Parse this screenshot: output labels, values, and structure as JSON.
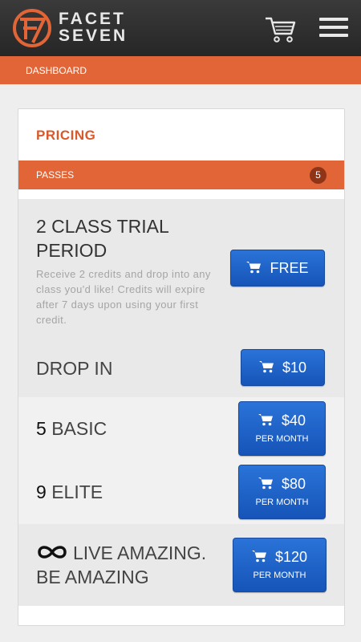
{
  "header": {
    "brand_line1": "FACET",
    "brand_line2": "SEVEN",
    "logo_icon": "facet-seven-logo",
    "cart_icon": "shopping-cart-icon",
    "menu_icon": "hamburger-menu-icon"
  },
  "breadcrumb": {
    "label": "DASHBOARD"
  },
  "pricing": {
    "title": "PRICING",
    "section_label": "PASSES",
    "section_count": "5",
    "plans": [
      {
        "name_line1": "2 CLASS TRIAL",
        "name_line2": "PERIOD",
        "description": "Receive 2 credits and drop into any class you'd like! Credits will expire after 7 days upon using your first credit.",
        "price": "FREE"
      },
      {
        "name": "DROP IN",
        "price": "$10"
      },
      {
        "name_num": "5",
        "name_text": "BASIC",
        "price": "$40",
        "period": "PER MONTH"
      },
      {
        "name_num": "9",
        "name_text": "ELITE",
        "price": "$80",
        "period": "PER MONTH"
      },
      {
        "name_line1": "LIVE AMAZING.",
        "name_line2": "BE AMAZING",
        "price": "$120",
        "period": "PER MONTH",
        "prefix_icon": "infinity-icon"
      }
    ]
  },
  "colors": {
    "accent_orange": "#e16536",
    "button_blue": "#1f63c8",
    "header_dark": "#2f2f2f"
  }
}
